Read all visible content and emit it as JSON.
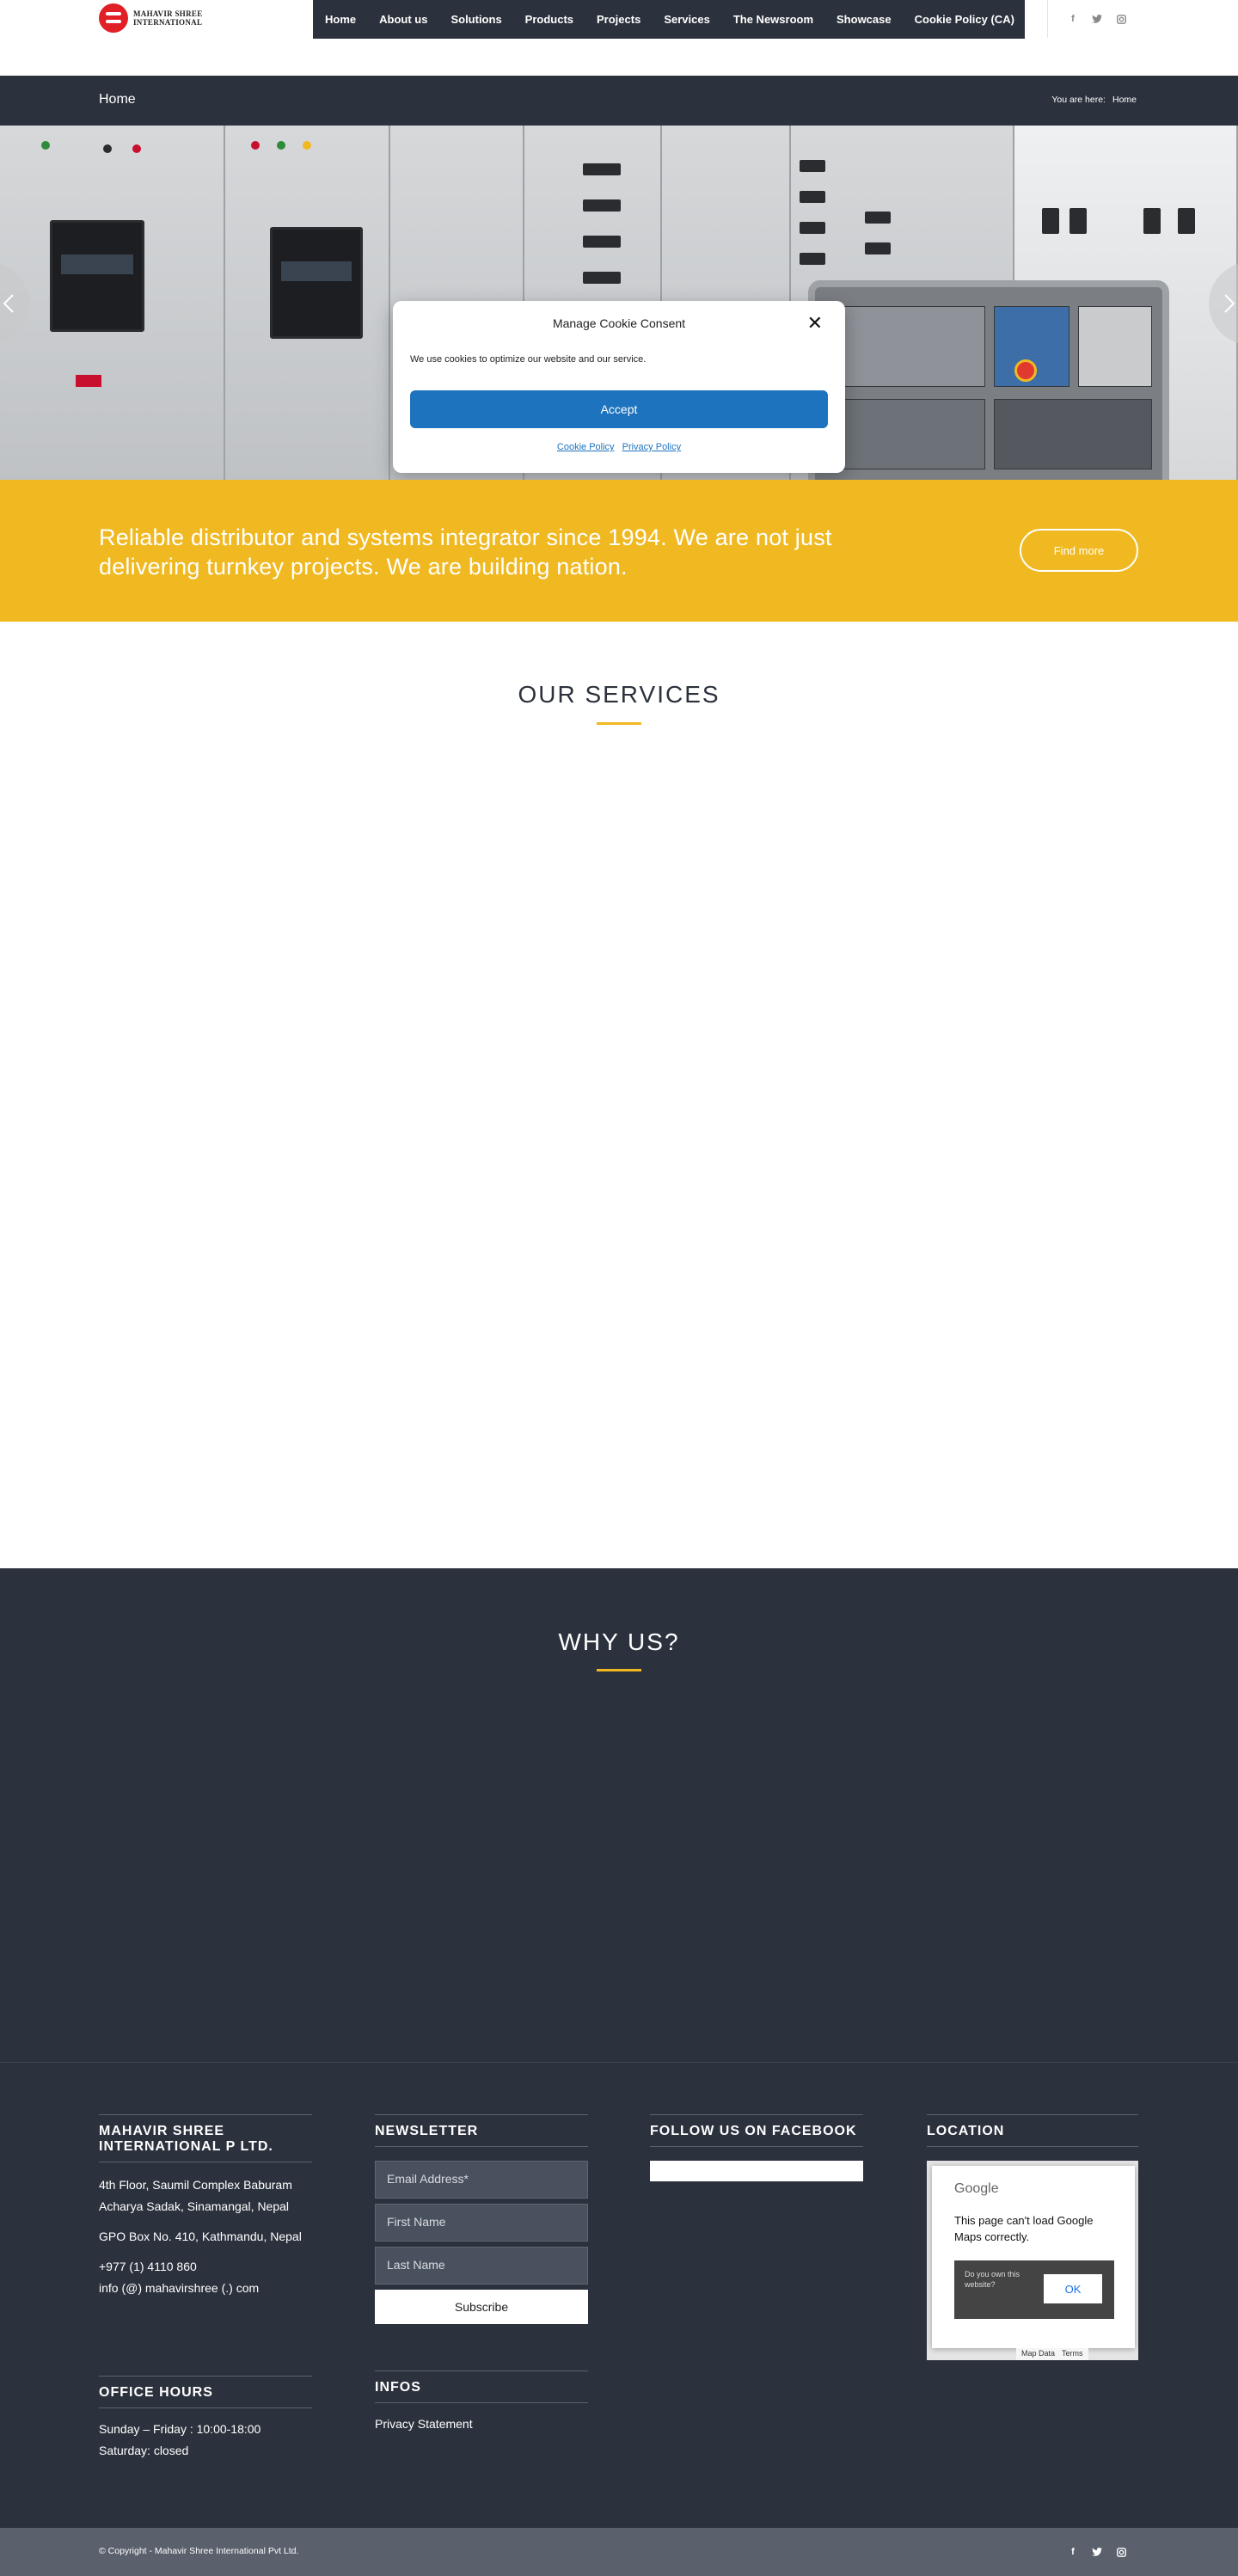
{
  "header": {
    "logo_line1": "MAHAVIR SHREE",
    "logo_line2": "INTERNATIONAL",
    "nav": [
      "Home",
      "About us",
      "Solutions",
      "Products",
      "Projects",
      "Services",
      "The Newsroom",
      "Showcase",
      "Cookie Policy (CA)"
    ],
    "social": [
      "f",
      "t",
      "ig"
    ]
  },
  "titlebar": {
    "title": "Home",
    "breadcrumb_label": "You are here:",
    "breadcrumb_current": "Home"
  },
  "cookie": {
    "title": "Manage Cookie Consent",
    "text": "We use cookies to optimize our website and our service.",
    "accept": "Accept",
    "link1": "Cookie Policy",
    "link2": "Privacy Policy",
    "close": "✕"
  },
  "band": {
    "text": "Reliable distributor and systems integrator since 1994. We are not just delivering turnkey projects. We are building nation.",
    "button": "Find more"
  },
  "services": {
    "title": "OUR SERVICES"
  },
  "why": {
    "title": "WHY US?"
  },
  "footer": {
    "company": {
      "heading": "MAHAVIR SHREE INTERNATIONAL P LTD.",
      "address": "4th Floor, Saumil Complex Baburam Acharya Sadak, Sinamangal, Nepal",
      "pobox": "GPO Box No. 410, Kathmandu, Nepal",
      "phone": "+977 (1) 4110 860",
      "email": "info (@) mahavirshree (.) com"
    },
    "hours": {
      "heading": "OFFICE HOURS",
      "line1": "Sunday – Friday : 10:00-18:00",
      "line2": "Saturday: closed"
    },
    "newsletter": {
      "heading": "NEWSLETTER",
      "email_placeholder": "Email Address*",
      "first_placeholder": "First Name",
      "last_placeholder": "Last Name",
      "subscribe": "Subscribe"
    },
    "infos": {
      "heading": "INFOS",
      "link": "Privacy Statement"
    },
    "facebook": {
      "heading": "FOLLOW US ON FACEBOOK"
    },
    "location": {
      "heading": "LOCATION",
      "brand": "Google",
      "message": "This page can't load Google Maps correctly.",
      "question": "Do you own this website?",
      "ok": "OK",
      "map_data": "Map Data",
      "terms": "Terms"
    }
  },
  "bottom": {
    "copyright": "© Copyright - Mahavir Shree International Pvt Ltd."
  }
}
